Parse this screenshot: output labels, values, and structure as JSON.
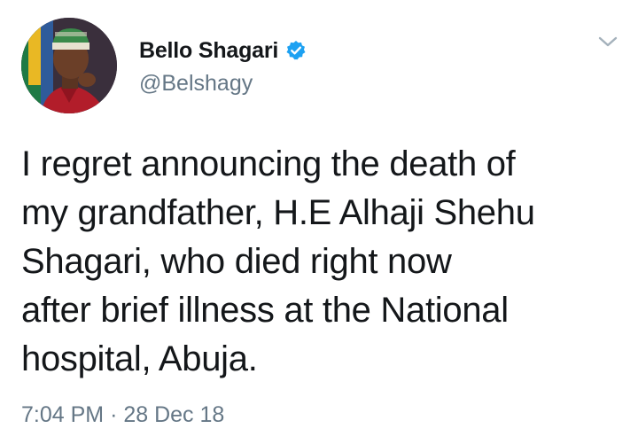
{
  "author": {
    "display_name": "Bello Shagari",
    "handle": "@Belshagy",
    "verified": true,
    "verified_icon": "verified-badge-icon",
    "avatar": "profile-photo"
  },
  "menu": {
    "icon": "chevron-down-icon"
  },
  "tweet": {
    "lines": [
      "I regret announcing the death of",
      "my grandfather, H.E Alhaji Shehu",
      "Shagari, who died right now",
      "after brief illness at the National",
      "hospital, Abuja."
    ],
    "time": "7:04 PM",
    "separator": "·",
    "date": "28 Dec 18"
  },
  "colors": {
    "text": "#14171a",
    "secondary": "#657786",
    "verified": "#1da1f2",
    "chevron": "#a4b1bb"
  }
}
